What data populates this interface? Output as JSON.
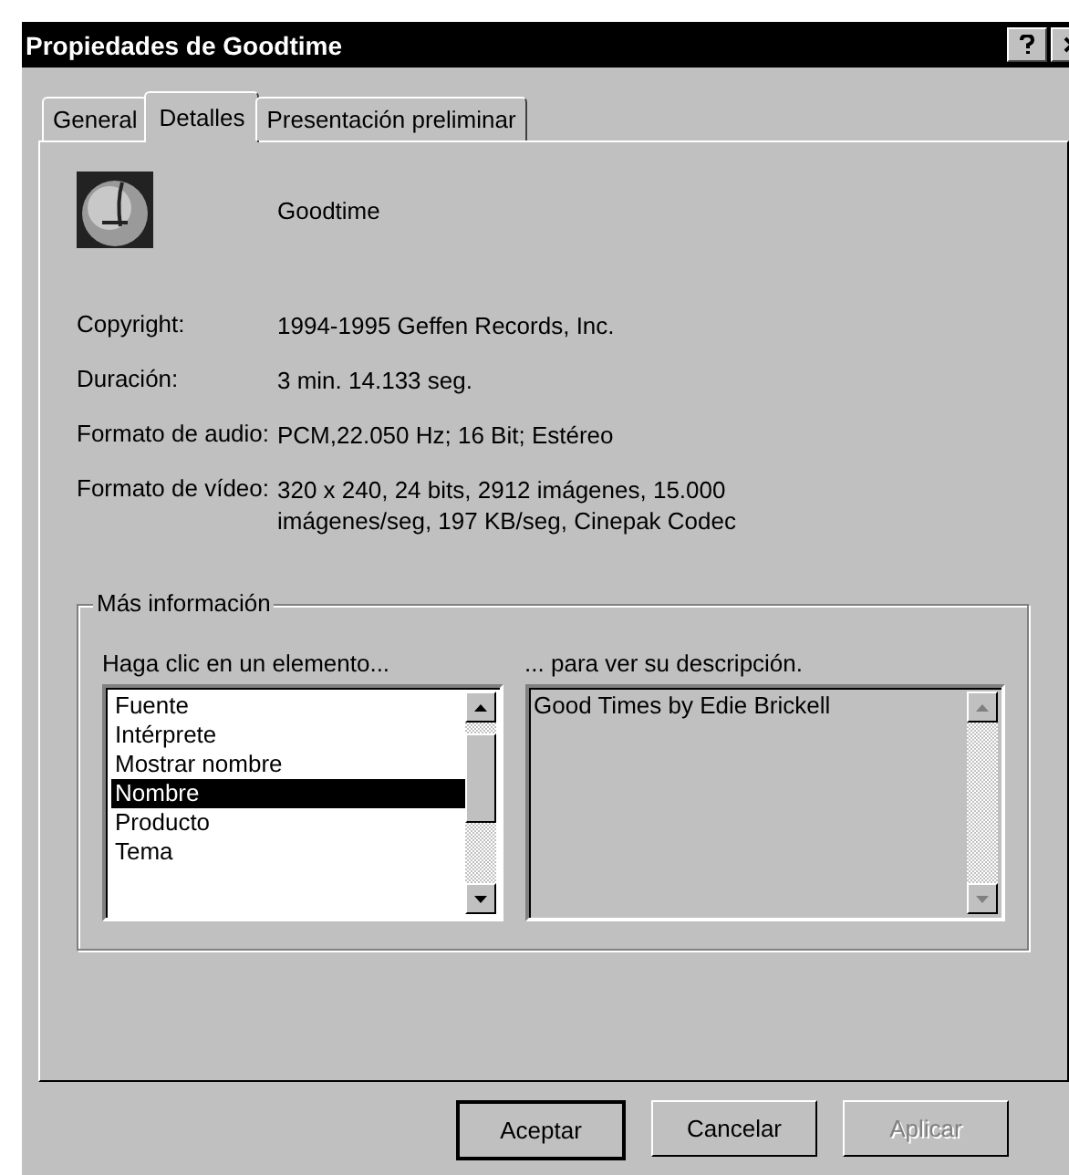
{
  "window": {
    "title": "Propiedades de Goodtime"
  },
  "tabs": [
    {
      "label": "General",
      "selected": false
    },
    {
      "label": "Detalles",
      "selected": true
    },
    {
      "label": "Presentación preliminar",
      "selected": false
    }
  ],
  "file_name": "Goodtime",
  "details": [
    {
      "label": "Copyright:",
      "value": "1994-1995 Geffen Records, Inc."
    },
    {
      "label": "Duración:",
      "value": "3 min. 14.133 seg."
    },
    {
      "label": "Formato de audio:",
      "value": "PCM,22.050 Hz; 16 Bit; Estéreo"
    },
    {
      "label": "Formato de vídeo:",
      "value": "320 x 240, 24 bits, 2912 imágenes, 15.000 imágenes/seg, 197 KB/seg, Cinepak Codec"
    }
  ],
  "more_info": {
    "title": "Más información",
    "list_label": "Haga clic en un elemento...",
    "description_label": "... para ver su descripción.",
    "items": [
      {
        "label": "Fuente",
        "selected": false
      },
      {
        "label": "Intérprete",
        "selected": false
      },
      {
        "label": "Mostrar nombre",
        "selected": false
      },
      {
        "label": "Nombre",
        "selected": true
      },
      {
        "label": "Producto",
        "selected": false
      },
      {
        "label": "Tema",
        "selected": false
      }
    ],
    "description": "Good Times by Edie Brickell"
  },
  "buttons": [
    {
      "label": "Aceptar",
      "disabled": false,
      "default": true
    },
    {
      "label": "Cancelar",
      "disabled": false,
      "default": false
    },
    {
      "label": "Aplicar",
      "disabled": true,
      "default": false
    }
  ]
}
